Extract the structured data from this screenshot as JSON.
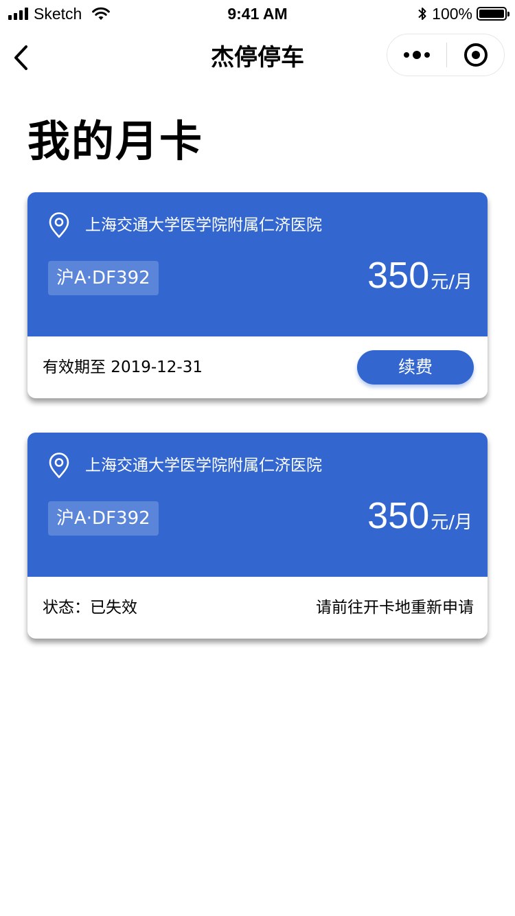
{
  "status_bar": {
    "carrier": "Sketch",
    "time": "9:41 AM",
    "battery": "100%",
    "icons": [
      "signal-icon",
      "wifi-icon",
      "bluetooth-icon",
      "battery-icon"
    ]
  },
  "nav": {
    "title": "杰停停车",
    "back_icon": "chevron-left-icon",
    "more_icon": "more-dots-icon",
    "close_icon": "target-icon"
  },
  "page": {
    "title": "我的月卡"
  },
  "cards": [
    {
      "location_icon": "location-pin-icon",
      "hospital": "上海交通大学医学院附属仁济医院",
      "plate": "沪A·DF392",
      "price": "350",
      "unit": "元/月",
      "footer_text": "有效期至 2019-12-31",
      "action_label": "续费"
    },
    {
      "location_icon": "location-pin-icon",
      "hospital": "上海交通大学医学院附属仁济医院",
      "plate": "沪A·DF392",
      "price": "350",
      "unit": "元/月",
      "status_text": "状态：已失效",
      "note": "请前往开卡地重新申请"
    }
  ],
  "colors": {
    "card_blue": "#3367cf",
    "plate_bg": "rgba(255,255,255,0.2)",
    "text_white": "#ffffff",
    "text_dark": "#000000"
  }
}
